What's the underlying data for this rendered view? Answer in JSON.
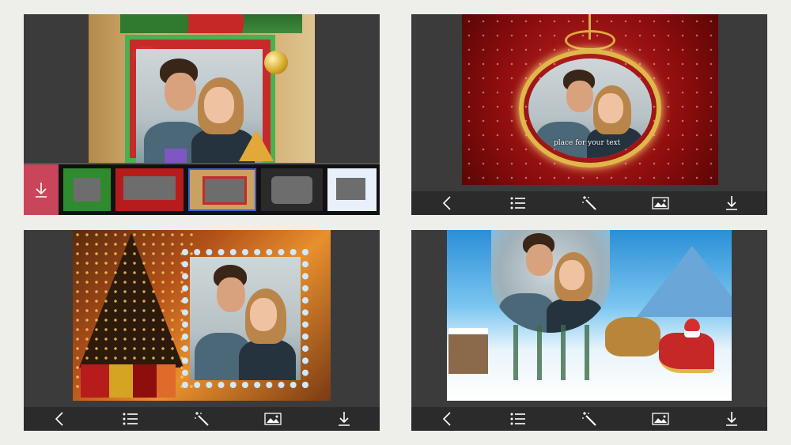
{
  "screens": [
    {
      "name": "christmas-gift-frame-editor",
      "thumbnails": [
        "green-frame",
        "red-frame",
        "gift-frame",
        "dark-frame",
        "blue-frame"
      ],
      "selected_thumbnail_index": 2
    },
    {
      "name": "ornament-frame-preview",
      "caption": "place for your text"
    },
    {
      "name": "snowflake-tree-frame-preview"
    },
    {
      "name": "santa-sleigh-frame-preview"
    }
  ],
  "toolbar_icons": [
    "back-icon",
    "list-icon",
    "magic-wand-icon",
    "image-icon",
    "download-icon"
  ],
  "colors": {
    "screen_bg": "#3b3b3b",
    "toolbar_bg": "#2b2b2b",
    "download_accent": "#c9455a",
    "selected_thumb_border": "#3a5fd6"
  }
}
